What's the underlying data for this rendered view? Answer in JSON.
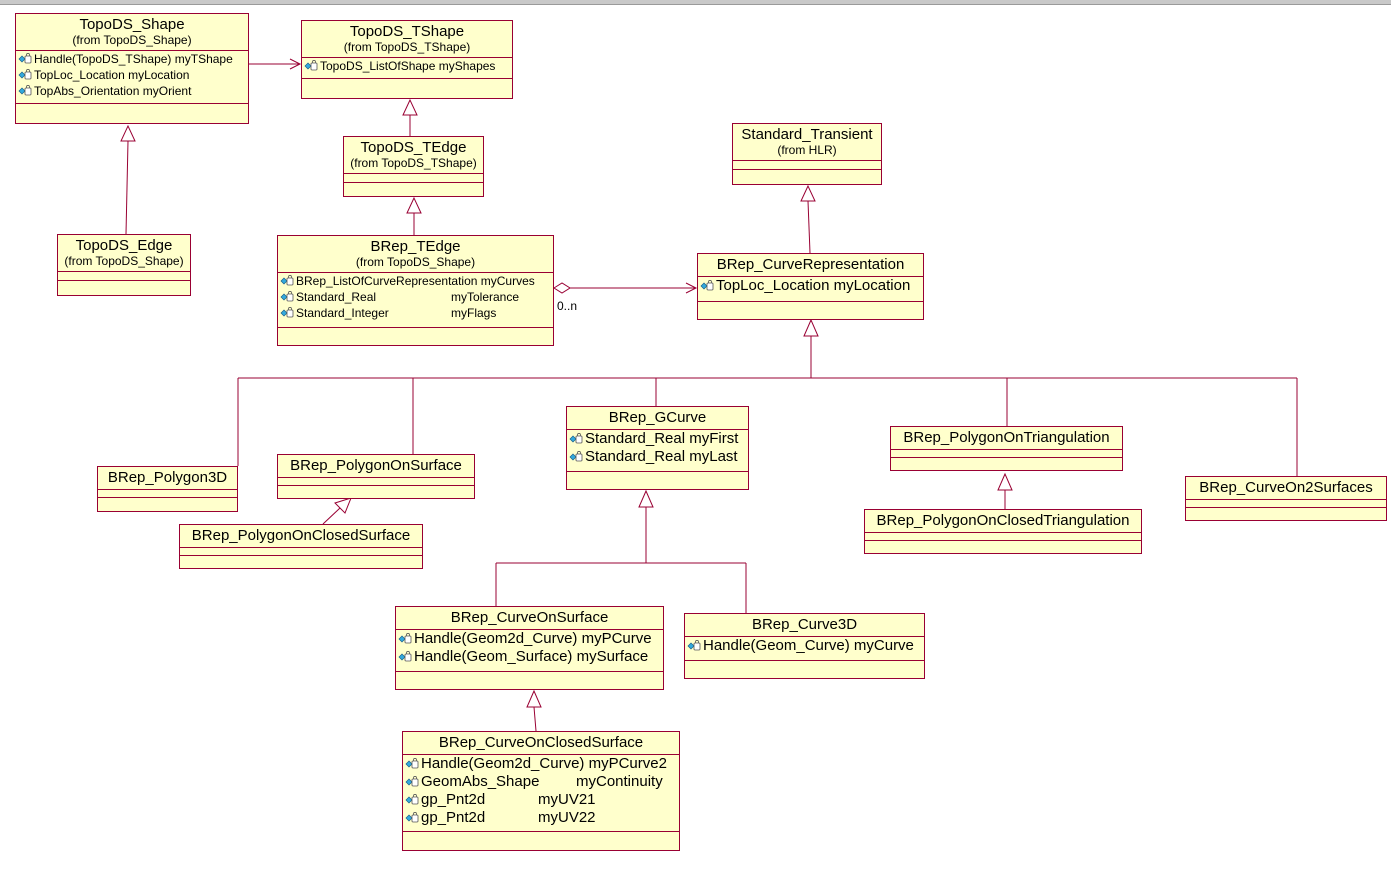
{
  "colors": {
    "box_fill": "#ffffcc",
    "box_border": "#990033",
    "attr_icon": "#33aadd"
  },
  "classes": [
    {
      "id": "topods_shape",
      "name": "TopoDS_Shape",
      "from": "(from TopoDS_Shape)",
      "attributes": [
        {
          "text": "Handle(TopoDS_TShape) myTShape"
        },
        {
          "text": "TopLoc_Location myLocation"
        },
        {
          "text": "TopAbs_Orientation myOrient"
        }
      ]
    },
    {
      "id": "topods_tshape",
      "name": "TopoDS_TShape",
      "from": "(from TopoDS_TShape)",
      "attributes": [
        {
          "text": "TopoDS_ListOfShape myShapes"
        }
      ]
    },
    {
      "id": "topods_tedge",
      "name": "TopoDS_TEdge",
      "from": "(from TopoDS_TShape)",
      "attributes": []
    },
    {
      "id": "topods_edge",
      "name": "TopoDS_Edge",
      "from": "(from TopoDS_Shape)",
      "attributes": []
    },
    {
      "id": "standard_transient",
      "name": "Standard_Transient",
      "from": "(from HLR)",
      "attributes": []
    },
    {
      "id": "brep_tedge",
      "name": "BRep_TEdge",
      "from": "(from TopoDS_Shape)",
      "attributes": [
        {
          "text": "BRep_ListOfCurveRepresentation myCurves"
        },
        {
          "text": "Standard_Real",
          "name": "myTolerance"
        },
        {
          "text": "Standard_Integer",
          "name": "myFlags"
        }
      ]
    },
    {
      "id": "brep_curverep",
      "name": "BRep_CurveRepresentation",
      "attributes": [
        {
          "text": "TopLoc_Location myLocation"
        }
      ]
    },
    {
      "id": "brep_polygon3d",
      "name": "BRep_Polygon3D",
      "attributes": []
    },
    {
      "id": "brep_polyonsurf",
      "name": "BRep_PolygonOnSurface",
      "attributes": []
    },
    {
      "id": "brep_polyonclosedsurf",
      "name": "BRep_PolygonOnClosedSurface",
      "attributes": []
    },
    {
      "id": "brep_gcurve",
      "name": "BRep_GCurve",
      "attributes": [
        {
          "text": "Standard_Real myFirst"
        },
        {
          "text": "Standard_Real myLast"
        }
      ]
    },
    {
      "id": "brep_polyontri",
      "name": "BRep_PolygonOnTriangulation",
      "attributes": []
    },
    {
      "id": "brep_polyonclosedtri",
      "name": "BRep_PolygonOnClosedTriangulation",
      "attributes": []
    },
    {
      "id": "brep_curveon2surf",
      "name": "BRep_CurveOn2Surfaces",
      "attributes": []
    },
    {
      "id": "brep_curveonsurf",
      "name": "BRep_CurveOnSurface",
      "attributes": [
        {
          "text": "Handle(Geom2d_Curve) myPCurve"
        },
        {
          "text": "Handle(Geom_Surface) mySurface"
        }
      ]
    },
    {
      "id": "brep_curve3d",
      "name": "BRep_Curve3D",
      "attributes": [
        {
          "text": "Handle(Geom_Curve) myCurve"
        }
      ]
    },
    {
      "id": "brep_curveonclosedsurf",
      "name": "BRep_CurveOnClosedSurface",
      "attributes": [
        {
          "text": "Handle(Geom2d_Curve) myPCurve2"
        },
        {
          "text": "GeomAbs_Shape",
          "name": "myContinuity"
        },
        {
          "text": "gp_Pnt2d",
          "name": "myUV21"
        },
        {
          "text": "gp_Pnt2d",
          "name": "myUV22"
        }
      ]
    }
  ],
  "relations": [
    {
      "type": "association",
      "from": "topods_shape",
      "to": "topods_tshape"
    },
    {
      "type": "generalization",
      "child": "topods_tedge",
      "parent": "topods_tshape"
    },
    {
      "type": "generalization",
      "child": "brep_tedge",
      "parent": "topods_tedge"
    },
    {
      "type": "generalization",
      "child": "topods_edge",
      "parent": "topods_shape"
    },
    {
      "type": "generalization",
      "child": "brep_curverep",
      "parent": "standard_transient"
    },
    {
      "type": "aggregation",
      "whole": "brep_tedge",
      "part": "brep_curverep",
      "multiplicity": "0..n"
    },
    {
      "type": "generalization",
      "child": "brep_polygon3d",
      "parent": "brep_curverep"
    },
    {
      "type": "generalization",
      "child": "brep_polyonsurf",
      "parent": "brep_curverep"
    },
    {
      "type": "generalization",
      "child": "brep_gcurve",
      "parent": "brep_curverep"
    },
    {
      "type": "generalization",
      "child": "brep_polyontri",
      "parent": "brep_curverep"
    },
    {
      "type": "generalization",
      "child": "brep_curveon2surf",
      "parent": "brep_curverep"
    },
    {
      "type": "generalization",
      "child": "brep_polyonclosedsurf",
      "parent": "brep_polyonsurf"
    },
    {
      "type": "generalization",
      "child": "brep_polyonclosedtri",
      "parent": "brep_polyontri"
    },
    {
      "type": "generalization",
      "child": "brep_curveonsurf",
      "parent": "brep_gcurve"
    },
    {
      "type": "generalization",
      "child": "brep_curve3d",
      "parent": "brep_gcurve"
    },
    {
      "type": "generalization",
      "child": "brep_curveonclosedsurf",
      "parent": "brep_curveonsurf"
    }
  ]
}
